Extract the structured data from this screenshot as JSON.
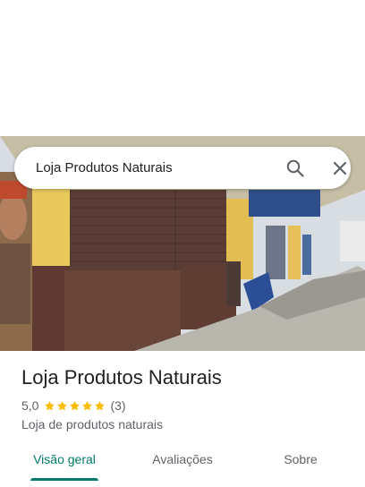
{
  "search": {
    "query": "Loja Produtos Naturais",
    "search_icon": "search-icon",
    "close_icon": "close-icon"
  },
  "place": {
    "title": "Loja Produtos Naturais",
    "rating": "5,0",
    "stars": 5,
    "review_count": "(3)",
    "category": "Loja de produtos naturais"
  },
  "tabs": [
    {
      "label": "Visão geral",
      "active": true
    },
    {
      "label": "Avaliações",
      "active": false
    },
    {
      "label": "Sobre",
      "active": false
    }
  ],
  "colors": {
    "accent": "#00796b",
    "star": "#fbbc04",
    "text_primary": "#202124",
    "text_secondary": "#5f6368"
  }
}
